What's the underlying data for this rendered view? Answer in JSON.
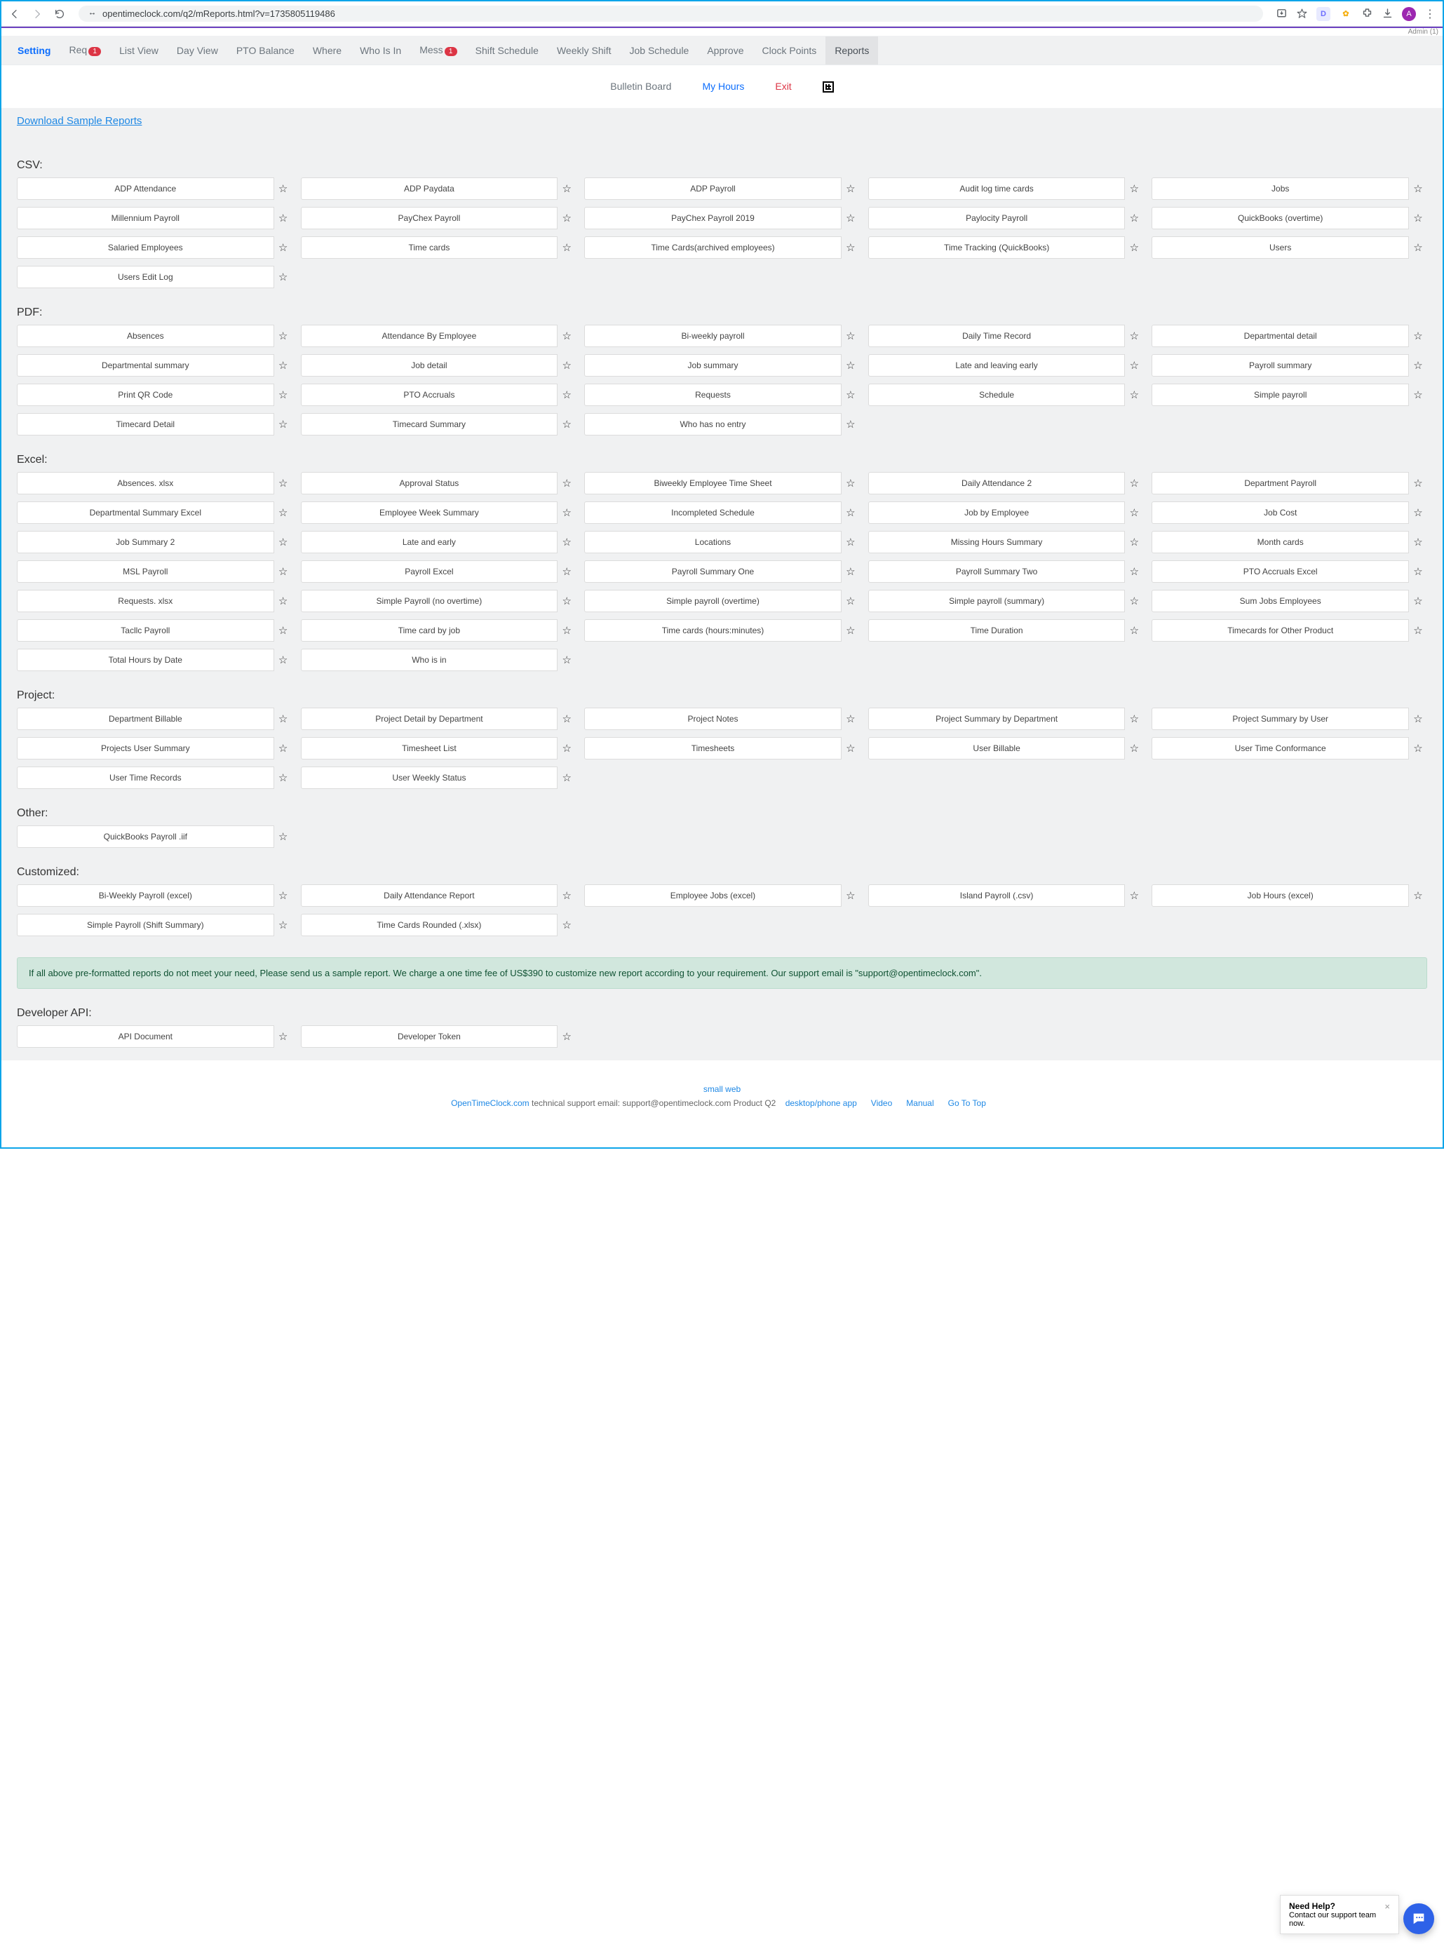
{
  "browser": {
    "url": "opentimeclock.com/q2/mReports.html?v=1735805119486"
  },
  "header": {
    "admin_label": "Admin (1)",
    "tabs": [
      {
        "key": "setting",
        "label": "Setting",
        "active": true
      },
      {
        "key": "req",
        "label": "Req",
        "badge": "1"
      },
      {
        "key": "listview",
        "label": "List View"
      },
      {
        "key": "dayview",
        "label": "Day View"
      },
      {
        "key": "pto",
        "label": "PTO Balance"
      },
      {
        "key": "where",
        "label": "Where"
      },
      {
        "key": "who",
        "label": "Who Is In"
      },
      {
        "key": "mess",
        "label": "Mess",
        "badge": "1"
      },
      {
        "key": "shift",
        "label": "Shift Schedule"
      },
      {
        "key": "weekly",
        "label": "Weekly Shift"
      },
      {
        "key": "job",
        "label": "Job Schedule"
      },
      {
        "key": "approve",
        "label": "Approve"
      },
      {
        "key": "clockpts",
        "label": "Clock Points"
      },
      {
        "key": "reports",
        "label": "Reports",
        "highlight": true
      }
    ],
    "secondary": [
      {
        "key": "bulletin",
        "label": "Bulletin Board"
      },
      {
        "key": "myhours",
        "label": "My Hours",
        "style": "blue"
      },
      {
        "key": "exit",
        "label": "Exit",
        "style": "red"
      },
      {
        "key": "qr",
        "icon": "qr"
      }
    ]
  },
  "download_link": "Download Sample Reports",
  "sections": [
    {
      "title": "CSV:",
      "items": [
        "ADP Attendance",
        "ADP Paydata",
        "ADP Payroll",
        "Audit log time cards",
        "Jobs",
        "Millennium Payroll",
        "PayChex Payroll",
        "PayChex Payroll 2019",
        "Paylocity Payroll",
        "QuickBooks (overtime)",
        "Salaried Employees",
        "Time cards",
        "Time Cards(archived employees)",
        "Time Tracking (QuickBooks)",
        "Users",
        "Users Edit Log"
      ]
    },
    {
      "title": "PDF:",
      "items": [
        "Absences",
        "Attendance By Employee",
        "Bi-weekly payroll",
        "Daily Time Record",
        "Departmental detail",
        "Departmental summary",
        "Job detail",
        "Job summary",
        "Late and leaving early",
        "Payroll summary",
        "Print QR Code",
        "PTO Accruals",
        "Requests",
        "Schedule",
        "Simple payroll",
        "Timecard Detail",
        "Timecard Summary",
        "Who has no entry"
      ]
    },
    {
      "title": "Excel:",
      "items": [
        "Absences. xlsx",
        "Approval Status",
        "Biweekly Employee Time Sheet",
        "Daily Attendance 2",
        "Department Payroll",
        "Departmental Summary Excel",
        "Employee Week Summary",
        "Incompleted Schedule",
        "Job by Employee",
        "Job Cost",
        "Job Summary 2",
        "Late and early",
        "Locations",
        "Missing Hours Summary",
        "Month cards",
        "MSL Payroll",
        "Payroll Excel",
        "Payroll Summary One",
        "Payroll Summary Two",
        "PTO Accruals Excel",
        "Requests. xlsx",
        "Simple Payroll (no overtime)",
        "Simple payroll (overtime)",
        "Simple payroll (summary)",
        "Sum Jobs Employees",
        "Tacllc Payroll",
        "Time card by job",
        "Time cards (hours:minutes)",
        "Time Duration",
        "Timecards for Other Product",
        "Total Hours by Date",
        "Who is in"
      ]
    },
    {
      "title": "Project:",
      "items": [
        "Department Billable",
        "Project Detail by Department",
        "Project Notes",
        "Project Summary by Department",
        "Project Summary by User",
        "Projects User Summary",
        "Timesheet List",
        "Timesheets",
        "User Billable",
        "User Time Conformance",
        "User Time Records",
        "User Weekly Status"
      ]
    },
    {
      "title": "Other:",
      "items": [
        "QuickBooks Payroll .iif"
      ]
    },
    {
      "title": "Customized:",
      "items": [
        "Bi-Weekly Payroll (excel)",
        "Daily Attendance Report",
        "Employee Jobs (excel)",
        "Island Payroll (.csv)",
        "Job Hours (excel)",
        "Simple Payroll (Shift Summary)",
        "Time Cards Rounded (.xlsx)"
      ]
    }
  ],
  "info_box": "If all above pre-formatted reports do not meet your need, Please send us a sample report. We charge a one time fee of US$390 to customize new report according to your requirement. Our support email is \"support@opentimeclock.com\".",
  "api_section": {
    "title": "Developer API:",
    "items": [
      "API Document",
      "Developer Token"
    ]
  },
  "footer": {
    "small_web": "small web",
    "company": "OpenTimeClock.com",
    "support_text": " technical support email: support@opentimeclock.com Product Q2",
    "links": [
      "desktop/phone app",
      "Video",
      "Manual",
      "Go To Top"
    ]
  },
  "help": {
    "title": "Need Help?",
    "body": "Contact our support team now."
  },
  "avatar_letter": "A"
}
